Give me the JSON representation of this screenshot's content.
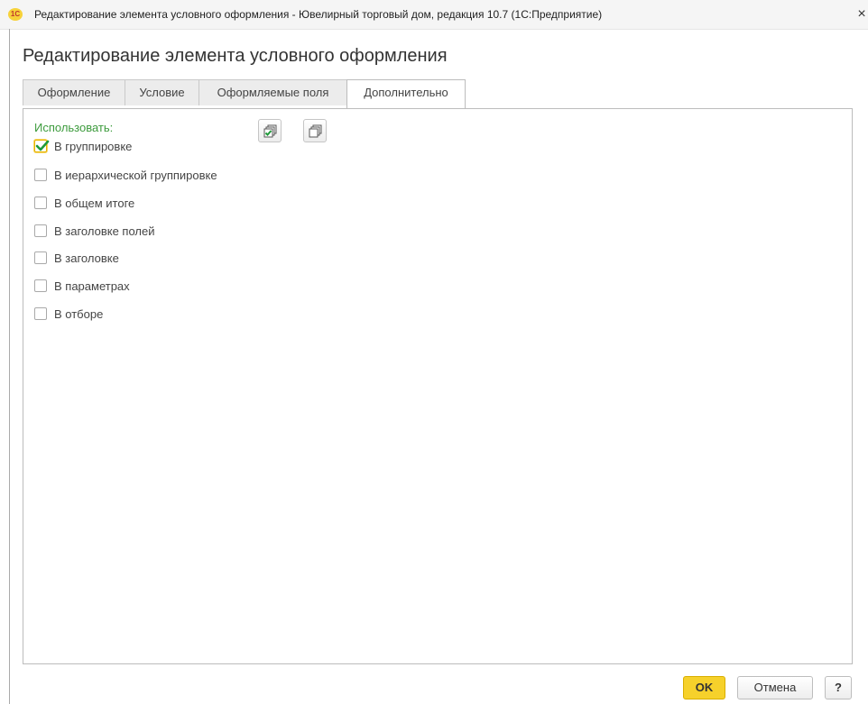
{
  "window": {
    "logo_text": "1С",
    "title": "Редактирование элемента условного оформления - Ювелирный торговый дом, редакция 10.7  (1С:Предприятие)",
    "close": "×"
  },
  "page_title": "Редактирование элемента условного оформления",
  "tabs": [
    {
      "label": "Оформление",
      "active": false
    },
    {
      "label": "Условие",
      "active": false
    },
    {
      "label": "Оформляемые поля",
      "active": false
    },
    {
      "label": "Дополнительно",
      "active": true
    }
  ],
  "use_section": {
    "label": "Использовать:",
    "toolbar": {
      "check_all_icon": "check-all-icon",
      "uncheck_all_icon": "uncheck-all-icon"
    },
    "options": [
      {
        "label": "В группировке",
        "checked": true
      },
      {
        "label": "В иерархической группировке",
        "checked": false
      },
      {
        "label": "В общем итоге",
        "checked": false
      },
      {
        "label": "В заголовке полей",
        "checked": false
      },
      {
        "label": "В заголовке",
        "checked": false
      },
      {
        "label": "В параметрах",
        "checked": false
      },
      {
        "label": "В отборе",
        "checked": false
      }
    ]
  },
  "buttons": {
    "ok": "OK",
    "cancel": "Отмена",
    "help": "?"
  },
  "colors": {
    "accent_yellow": "#f6d12b",
    "label_green": "#3d9b3d",
    "check_green": "#1f9a3a"
  }
}
